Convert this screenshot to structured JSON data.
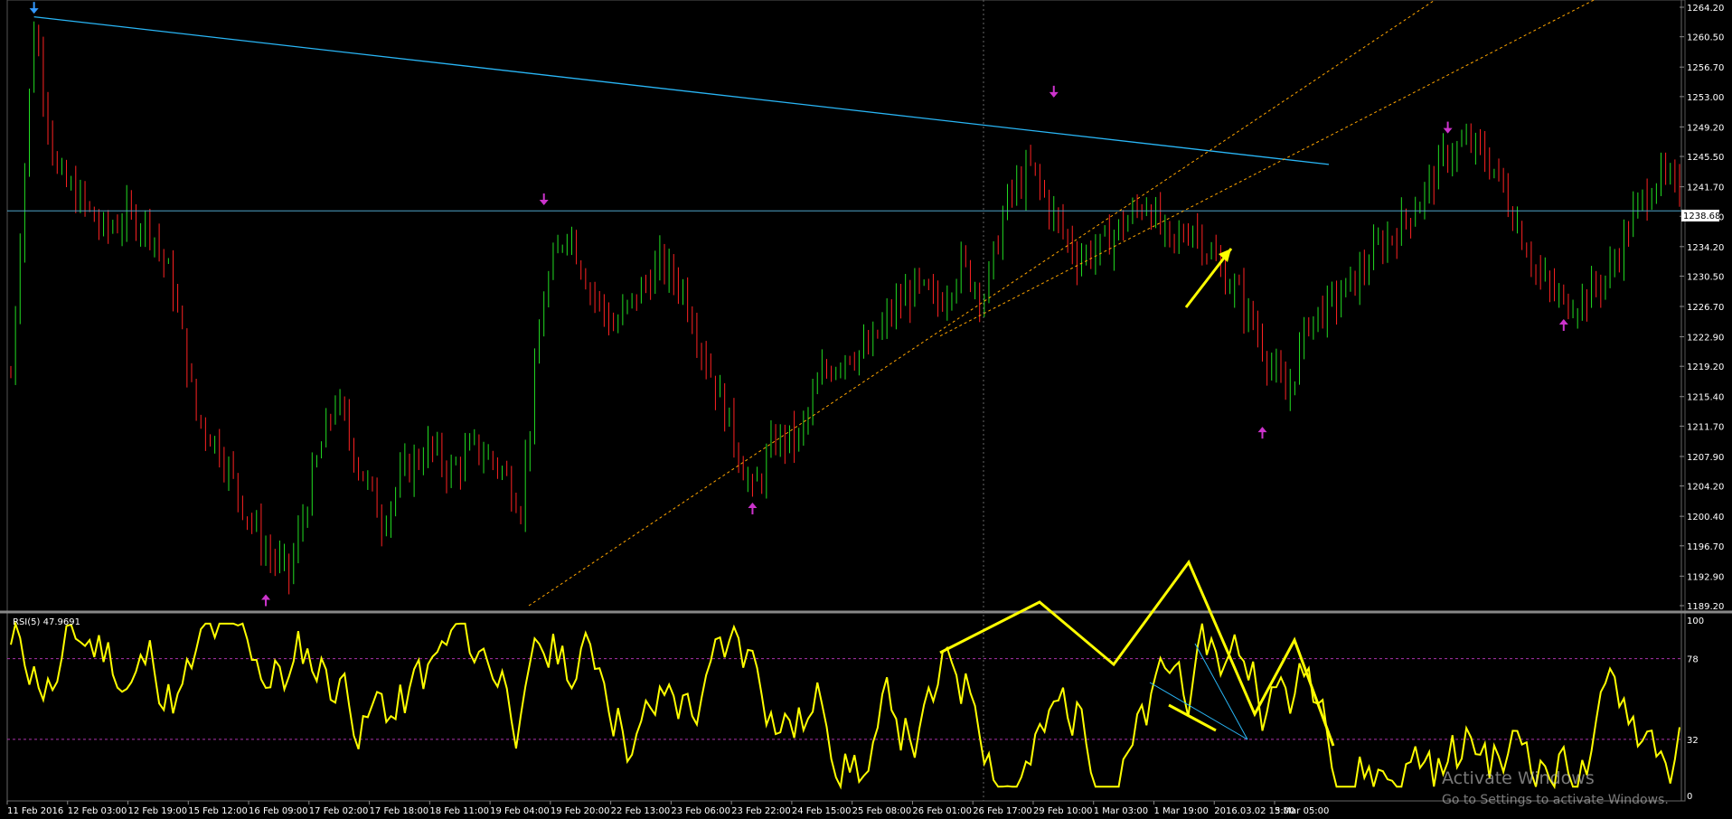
{
  "chart_data": [
    {
      "type": "candlestick",
      "title": "",
      "price_ticks": [
        "1264.20",
        "1260.50",
        "1256.70",
        "1253.00",
        "1249.20",
        "1245.50",
        "1241.70",
        "1238.00",
        "1234.20",
        "1230.50",
        "1226.70",
        "1222.90",
        "1219.20",
        "1215.40",
        "1211.70",
        "1207.90",
        "1204.20",
        "1200.40",
        "1196.70",
        "1192.90",
        "1189.20"
      ],
      "ylim": [
        1189.2,
        1264.2
      ],
      "current_price": "1238.68",
      "time_ticks": [
        "11 Feb 2016",
        "12 Feb 03:00",
        "12 Feb 19:00",
        "15 Feb 12:00",
        "16 Feb 09:00",
        "17 Feb 02:00",
        "17 Feb 18:00",
        "18 Feb 11:00",
        "19 Feb 04:00",
        "19 Feb 20:00",
        "22 Feb 13:00",
        "23 Feb 06:00",
        "23 Feb 22:00",
        "24 Feb 15:00",
        "25 Feb 08:00",
        "26 Feb 01:00",
        "26 Feb 17:00",
        "29 Feb 10:00",
        "1 Mar 03:00",
        "1 Mar 19:00",
        "2016.03.02 15:00",
        "3 Mar 05:00"
      ],
      "path": [
        [
          0,
          1218
        ],
        [
          5,
          1262
        ],
        [
          10,
          1243
        ],
        [
          15,
          1240
        ],
        [
          20,
          1236
        ],
        [
          25,
          1238
        ],
        [
          30,
          1237
        ],
        [
          35,
          1229
        ],
        [
          40,
          1213
        ],
        [
          45,
          1209
        ],
        [
          50,
          1202
        ],
        [
          55,
          1196
        ],
        [
          60,
          1193
        ],
        [
          65,
          1205
        ],
        [
          70,
          1215
        ],
        [
          75,
          1207
        ],
        [
          80,
          1200
        ],
        [
          85,
          1206
        ],
        [
          90,
          1209
        ],
        [
          95,
          1206
        ],
        [
          100,
          1209
        ],
        [
          105,
          1207
        ],
        [
          110,
          1202
        ],
        [
          115,
          1228
        ],
        [
          120,
          1237
        ],
        [
          125,
          1229
        ],
        [
          130,
          1224
        ],
        [
          135,
          1228
        ],
        [
          140,
          1232
        ],
        [
          145,
          1229
        ],
        [
          150,
          1220
        ],
        [
          155,
          1212
        ],
        [
          160,
          1203
        ],
        [
          165,
          1210
        ],
        [
          170,
          1210
        ],
        [
          175,
          1218
        ],
        [
          180,
          1221
        ],
        [
          185,
          1221
        ],
        [
          190,
          1226
        ],
        [
          195,
          1229
        ],
        [
          200,
          1227
        ],
        [
          205,
          1232
        ],
        [
          210,
          1228
        ],
        [
          215,
          1240
        ],
        [
          220,
          1244
        ],
        [
          225,
          1238
        ],
        [
          230,
          1233
        ],
        [
          235,
          1234
        ],
        [
          240,
          1237
        ],
        [
          245,
          1240
        ],
        [
          250,
          1234
        ],
        [
          255,
          1237
        ],
        [
          260,
          1232
        ],
        [
          265,
          1228
        ],
        [
          270,
          1222
        ],
        [
          275,
          1215
        ],
        [
          280,
          1225
        ],
        [
          285,
          1227
        ],
        [
          290,
          1230
        ],
        [
          295,
          1234
        ],
        [
          300,
          1237
        ],
        [
          305,
          1241
        ],
        [
          310,
          1246
        ],
        [
          315,
          1247
        ],
        [
          320,
          1244
        ],
        [
          325,
          1237
        ],
        [
          330,
          1230
        ],
        [
          335,
          1227
        ],
        [
          340,
          1228
        ],
        [
          345,
          1231
        ],
        [
          350,
          1238
        ],
        [
          355,
          1243
        ],
        [
          360,
          1241
        ]
      ],
      "swing_markers": [
        {
          "label": "high",
          "time": 5,
          "price": 1263.5,
          "dir": "down",
          "color": "#3399ff"
        },
        {
          "label": "low",
          "time": 55,
          "price": 1190.5,
          "dir": "up",
          "color": "#cc33cc"
        },
        {
          "label": "high",
          "time": 115,
          "price": 1239.5,
          "dir": "down",
          "color": "#cc33cc"
        },
        {
          "label": "low",
          "time": 160,
          "price": 1202.0,
          "dir": "up",
          "color": "#cc33cc"
        },
        {
          "label": "high",
          "time": 225,
          "price": 1253.0,
          "dir": "down",
          "color": "#cc33cc"
        },
        {
          "label": "low",
          "time": 270,
          "price": 1211.5,
          "dir": "up",
          "color": "#cc33cc"
        },
        {
          "label": "high",
          "time": 310,
          "price": 1248.5,
          "dir": "down",
          "color": "#cc33cc"
        },
        {
          "label": "low",
          "time": 335,
          "price": 1225.0,
          "dir": "up",
          "color": "#cc33cc"
        }
      ],
      "colors": {
        "up": "#22dd22",
        "down": "#ff2222",
        "trendline": "#29b6f6",
        "channel": "#ffa500",
        "marker": "#cc33cc",
        "annotation": "#ffff00"
      }
    },
    {
      "type": "line",
      "title": "RSI(5) 47.9691",
      "ylim": [
        0,
        100
      ],
      "levels": [
        78,
        32
      ],
      "y_ticks": [
        "100",
        "78",
        "32",
        "0"
      ],
      "series": [
        {
          "name": "RSI(5)",
          "color": "#ffff00"
        }
      ]
    }
  ],
  "watermark": {
    "line1": "Activate Windows",
    "line2": "Go to Settings to activate Windows."
  }
}
